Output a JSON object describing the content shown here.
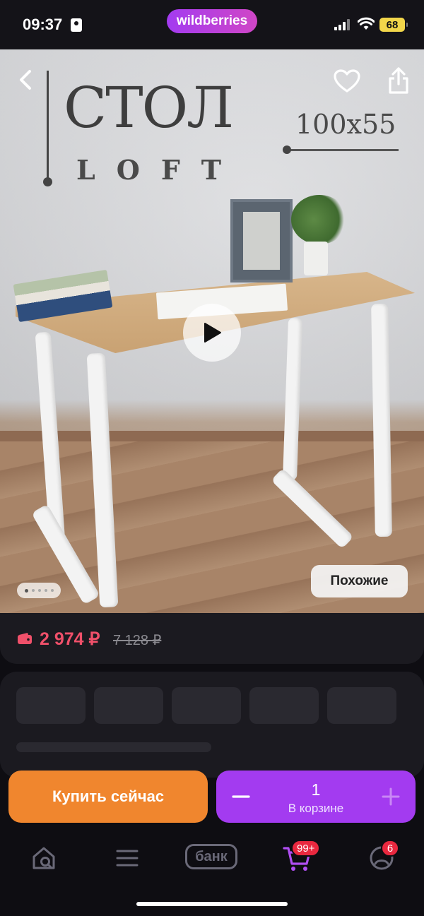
{
  "status_bar": {
    "time": "09:37",
    "brand": "wildberries",
    "battery": "68"
  },
  "product_image": {
    "headline": "СТОЛ",
    "subline": "LOFT",
    "size_text": "100x55",
    "similar_label": "Похожие",
    "gallery_index": 1,
    "gallery_count": 5
  },
  "price": {
    "current": "2 974 ₽",
    "old": "7 128 ₽",
    "current_color": "#f0506a"
  },
  "actions": {
    "buy_label": "Купить сейчас",
    "cart_qty": "1",
    "cart_label": "В корзине",
    "buy_color": "#f0862e",
    "cart_color": "#a33bf0"
  },
  "tabbar": {
    "bank_label": "банк",
    "cart_badge": "99+",
    "profile_badge": "6",
    "icons": [
      "home-search-icon",
      "menu-icon",
      "bank-icon",
      "cart-icon",
      "profile-icon"
    ]
  }
}
